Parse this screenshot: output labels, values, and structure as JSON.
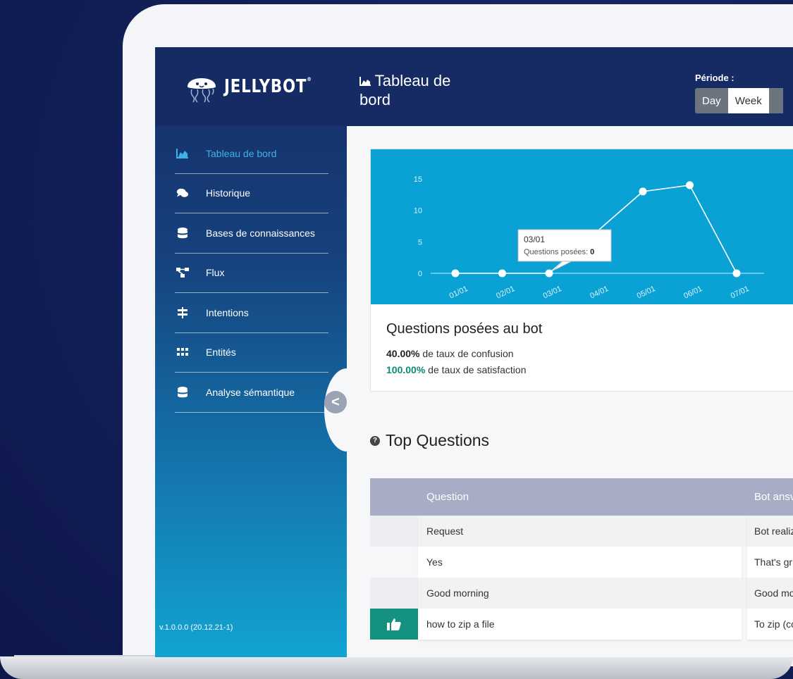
{
  "app": {
    "brand": "JELLYBOT",
    "brand_mark": "®",
    "version": "v.1.0.0.0 (20.12.21-1)"
  },
  "sidebar": {
    "items": [
      {
        "label": "Tableau de bord",
        "icon": "area-chart-icon",
        "active": true
      },
      {
        "label": "Historique",
        "icon": "comments-icon",
        "active": false
      },
      {
        "label": "Bases de connaissances",
        "icon": "database-icon",
        "active": false
      },
      {
        "label": "Flux",
        "icon": "flow-icon",
        "active": false
      },
      {
        "label": "Intentions",
        "icon": "signpost-icon",
        "active": false
      },
      {
        "label": "Entités",
        "icon": "grid-icon",
        "active": false
      },
      {
        "label": "Analyse sémantique",
        "icon": "database-icon",
        "active": false
      }
    ],
    "collapse_glyph": "<"
  },
  "header": {
    "title_line1": "Tableau de",
    "title_line2": "bord",
    "periode_label": "Période :",
    "periods": [
      "Day",
      "Week"
    ],
    "active_period": "Day"
  },
  "colors": {
    "header_bg": "#162b63",
    "chart_bg": "#0aa2d5",
    "accent_active": "#3fb2e6",
    "satisfaction": "#0e8a78",
    "table_header": "#a8acc4"
  },
  "chart_data": {
    "type": "line",
    "x": [
      "01/01",
      "02/01",
      "03/01",
      "04/01",
      "05/01",
      "06/01",
      "07/01"
    ],
    "series": [
      {
        "values": [
          0,
          0,
          0,
          null,
          13,
          14,
          0
        ]
      }
    ],
    "y_ticks": [
      0,
      5,
      10,
      15
    ],
    "ylim": [
      0,
      15
    ],
    "tooltip": {
      "title": "03/01",
      "label": "Questions posées: ",
      "value": "0"
    }
  },
  "card": {
    "title": "Questions posées au bot",
    "confusion_value": "40.00%",
    "confusion_text": " de taux de confusion",
    "satisfaction_value": "100.00%",
    "satisfaction_text": " de taux de satisfaction"
  },
  "top_questions": {
    "heading": "Top Questions",
    "columns": [
      "Question",
      "Bot ansv"
    ],
    "rows": [
      {
        "question": "Request",
        "answer": "Bot realiz",
        "flag": ""
      },
      {
        "question": "Yes",
        "answer": "That's gr",
        "flag": ""
      },
      {
        "question": "Good morning",
        "answer": "Good mo",
        "flag": ""
      },
      {
        "question": "how to zip a file",
        "answer": "To zip (co",
        "flag": "thumbs-up-icon"
      }
    ]
  }
}
